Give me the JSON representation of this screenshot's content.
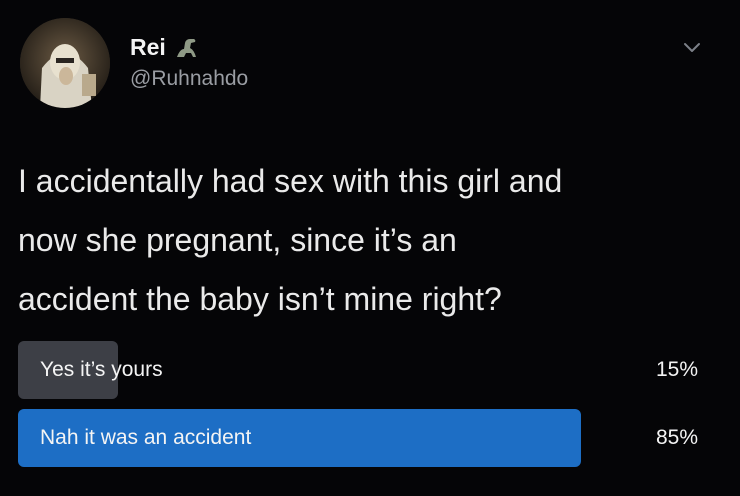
{
  "user": {
    "display_name": "Rei",
    "handle": "@Ruhnahdo",
    "name_emoji": "dinosaur-emoji"
  },
  "tweet": {
    "text": "I accidentally had sex with this girl and\nnow she pregnant, since it’s an\naccident the baby isn’t mine right?"
  },
  "poll": {
    "options": [
      {
        "label": "Yes it’s yours",
        "percent": "15%",
        "fraction": 0.15,
        "bar_color": "#3d3f46"
      },
      {
        "label": "Nah it was an accident",
        "percent": "85%",
        "fraction": 0.85,
        "bar_color": "#1d6ec5"
      }
    ]
  },
  "icons": {
    "menu": "chevron-down-icon"
  }
}
